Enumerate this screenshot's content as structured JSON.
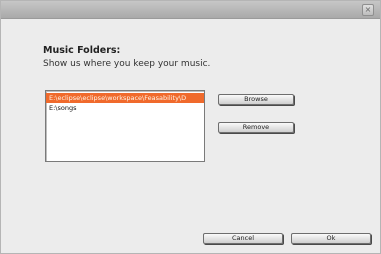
{
  "window": {
    "close_glyph": "×"
  },
  "heading": "Music Folders:",
  "subheading": "Show us where you keep your music.",
  "folders": {
    "items": [
      "E:\\eclipse\\eclipse\\workspace\\Feasability\\D",
      "E:\\songs"
    ],
    "selected_index": 0
  },
  "buttons": {
    "browse": "Browse",
    "remove": "Remove",
    "cancel": "Cancel",
    "ok": "Ok"
  },
  "colors": {
    "selection": "#f06a2c",
    "titlebar": "#b8b8b8",
    "dialog_bg": "#ececec"
  }
}
